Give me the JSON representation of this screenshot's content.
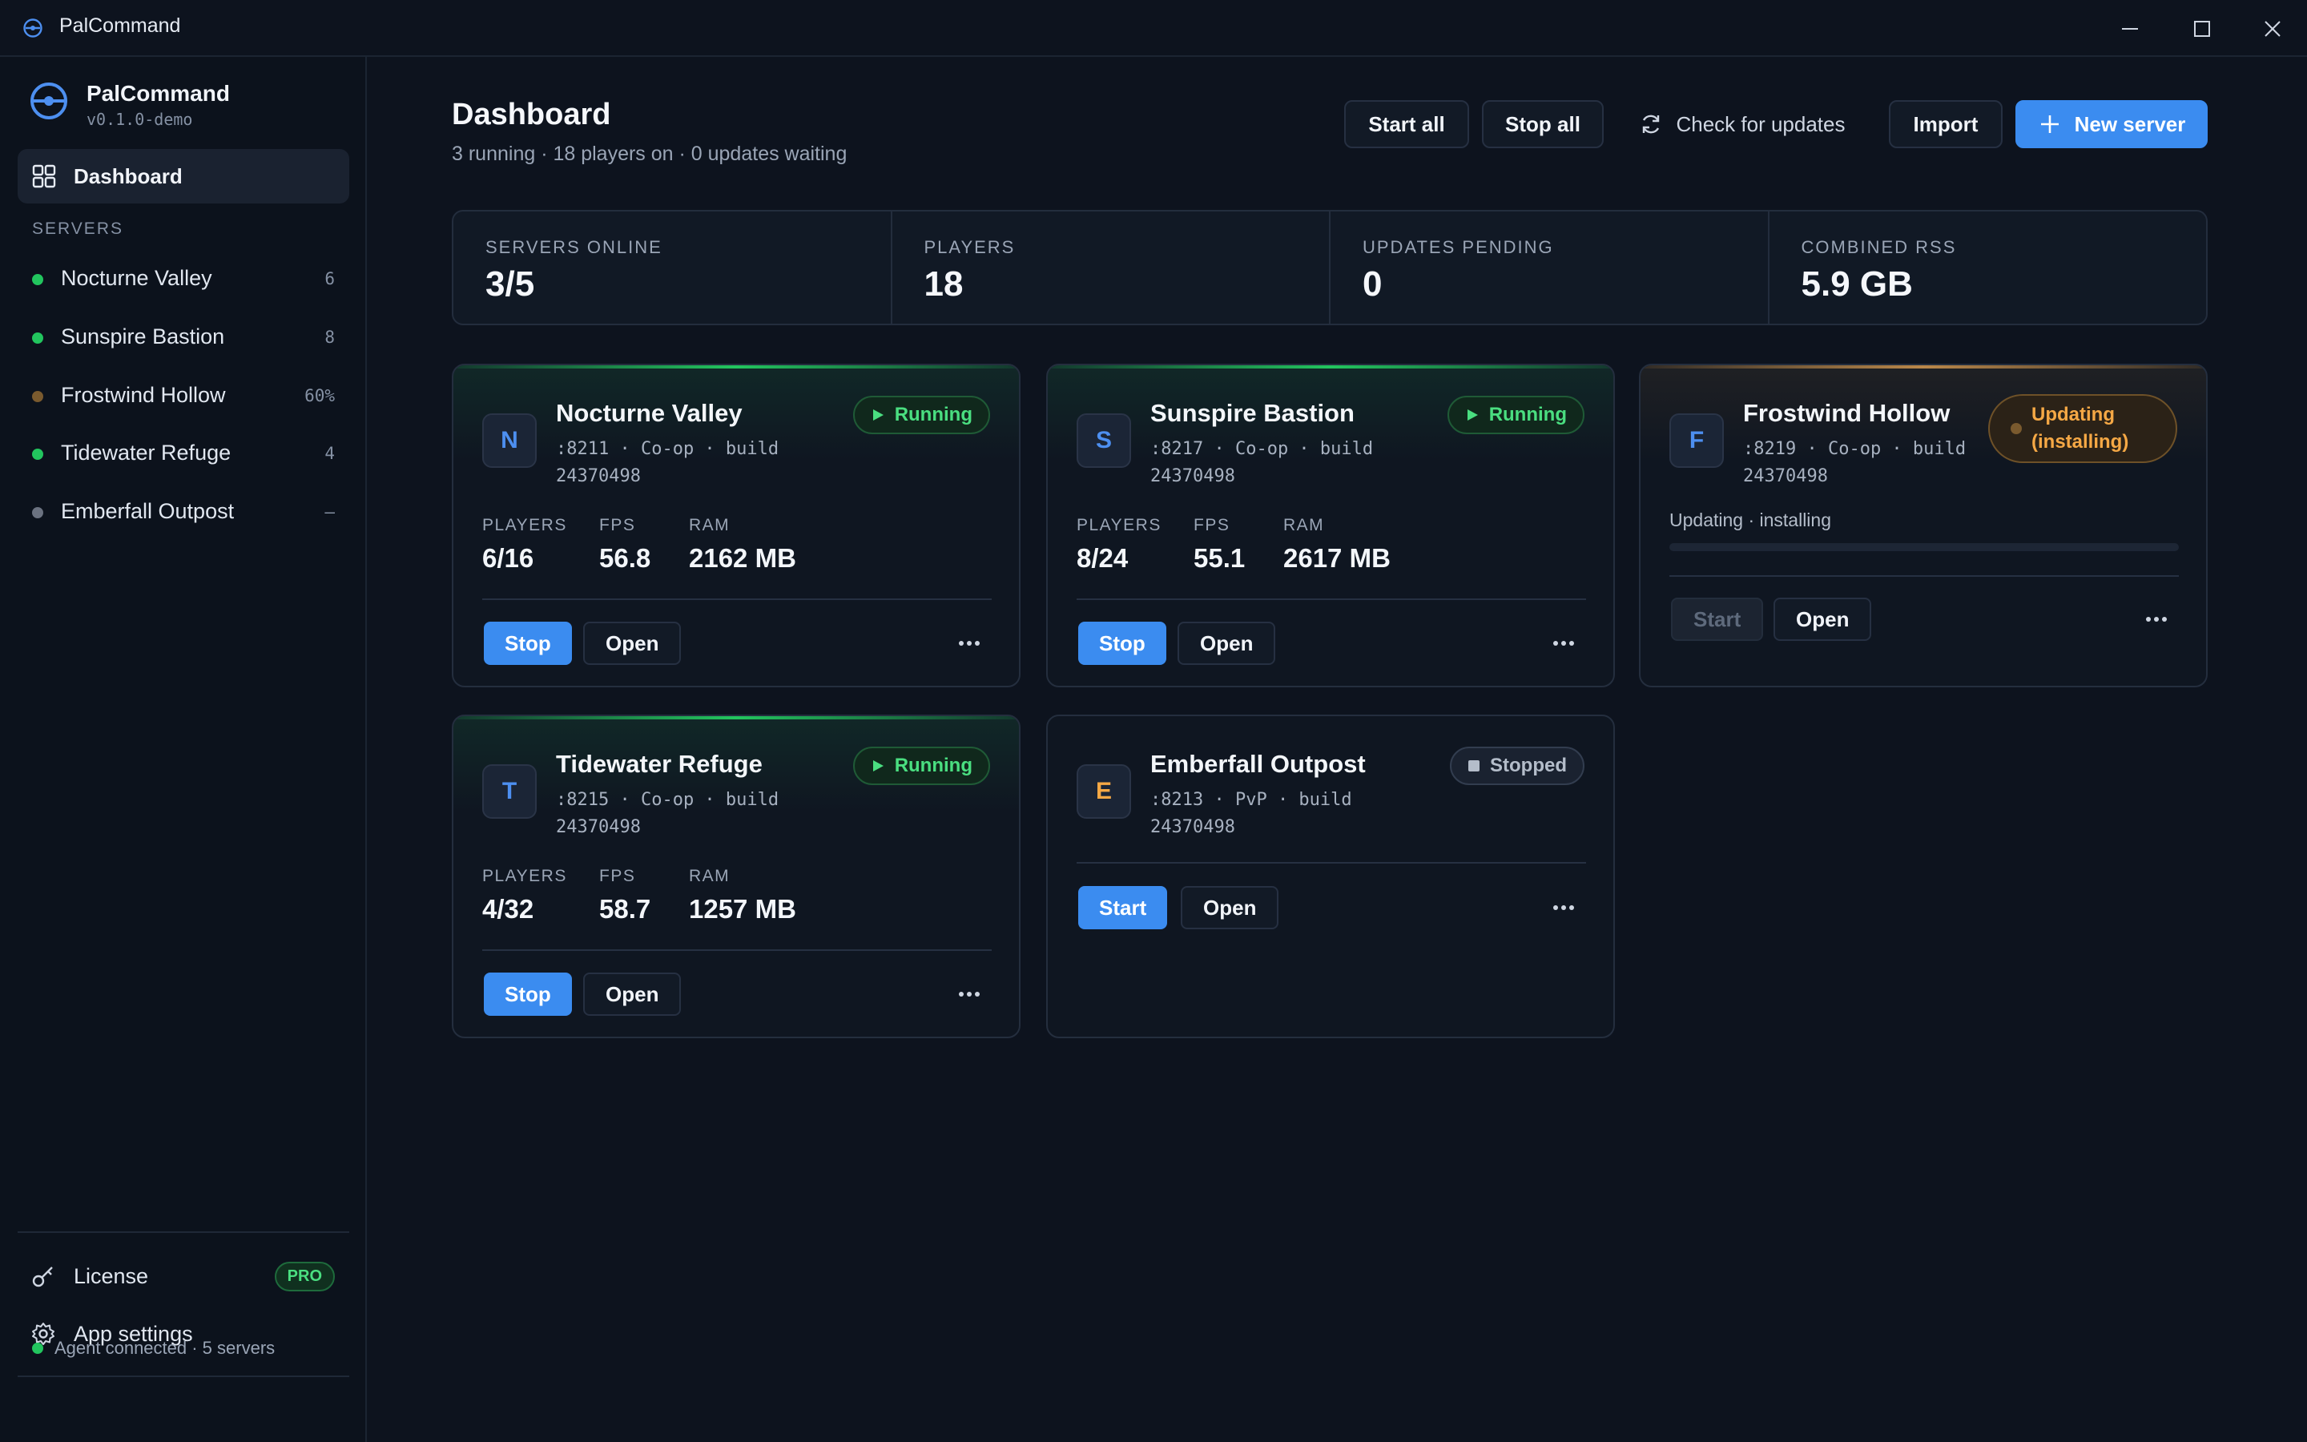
{
  "window": {
    "title": "PalCommand"
  },
  "sidebar": {
    "brand_name": "PalCommand",
    "version": "v0.1.0-demo",
    "dashboard_label": "Dashboard",
    "servers_section": "SERVERS",
    "servers": [
      {
        "name": "Nocturne Valley",
        "count": "6",
        "status_color": "#22c55e"
      },
      {
        "name": "Sunspire Bastion",
        "count": "8",
        "status_color": "#22c55e"
      },
      {
        "name": "Frostwind Hollow",
        "count": "60%",
        "status_color": "#7a5a2e"
      },
      {
        "name": "Tidewater Refuge",
        "count": "4",
        "status_color": "#22c55e"
      },
      {
        "name": "Emberfall Outpost",
        "count": "–",
        "status_color": "#6b7280"
      }
    ],
    "license_label": "License",
    "license_badge": "PRO",
    "settings_label": "App settings",
    "agent_status": "Agent connected · 5 servers"
  },
  "header": {
    "title": "Dashboard",
    "subtitle": "3 running · 18 players on · 0 updates waiting",
    "start_all": "Start all",
    "stop_all": "Stop all",
    "check_updates": "Check for updates",
    "import": "Import",
    "new_server": "New server"
  },
  "stats": [
    {
      "label": "SERVERS ONLINE",
      "value": "3/5"
    },
    {
      "label": "PLAYERS",
      "value": "18"
    },
    {
      "label": "UPDATES PENDING",
      "value": "0"
    },
    {
      "label": "COMBINED RSS",
      "value": "5.9 GB"
    }
  ],
  "metric_labels": {
    "players": "PLAYERS",
    "fps": "FPS",
    "ram": "RAM"
  },
  "cards": [
    {
      "initial": "N",
      "name": "Nocturne Valley",
      "meta": ":8211 · Co-op · build 24370498",
      "status": "Running",
      "players": "6/16",
      "fps": "56.8",
      "ram": "2162 MB",
      "primary_action": "Stop",
      "secondary_action": "Open"
    },
    {
      "initial": "S",
      "name": "Sunspire Bastion",
      "meta": ":8217 · Co-op · build 24370498",
      "status": "Running",
      "players": "8/24",
      "fps": "55.1",
      "ram": "2617 MB",
      "primary_action": "Stop",
      "secondary_action": "Open"
    },
    {
      "initial": "F",
      "name": "Frostwind Hollow",
      "meta": ":8219 · Co-op · build 24370498",
      "status": "Updating (installing)",
      "progress_label": "Updating · installing",
      "progress": 0,
      "primary_action": "Start",
      "secondary_action": "Open"
    },
    {
      "initial": "T",
      "name": "Tidewater Refuge",
      "meta": ":8215 · Co-op · build 24370498",
      "status": "Running",
      "players": "4/32",
      "fps": "58.7",
      "ram": "1257 MB",
      "primary_action": "Stop",
      "secondary_action": "Open"
    },
    {
      "initial": "E",
      "name": "Emberfall Outpost",
      "meta": ":8213 · PvP · build 24370498",
      "status": "Stopped",
      "primary_action": "Start",
      "secondary_action": "Open"
    }
  ],
  "colors": {
    "accent": "#3b8cf0",
    "running": "#4ade80",
    "updating": "#f5a845",
    "stopped": "#b4bdca"
  }
}
